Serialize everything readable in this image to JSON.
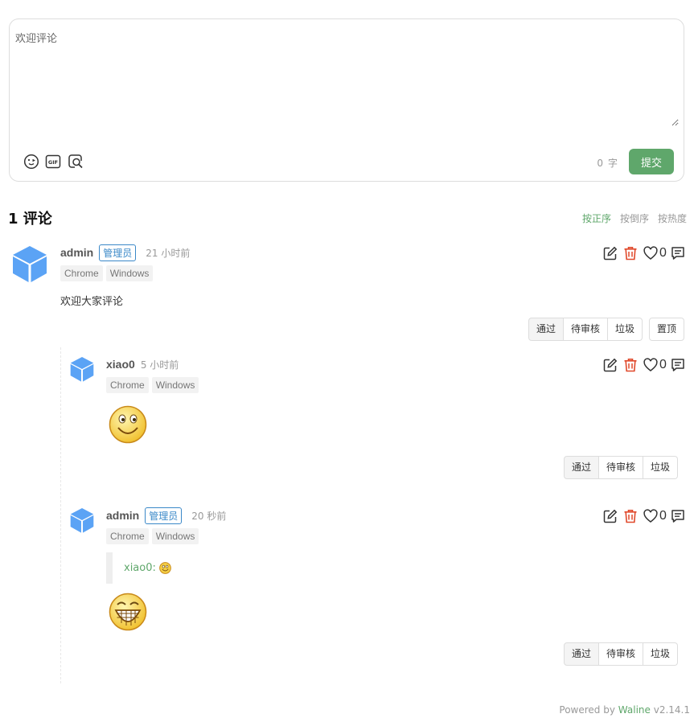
{
  "editor": {
    "placeholder": "欢迎评论",
    "tools": [
      "emoji-icon",
      "gif-icon",
      "search-icon"
    ],
    "count_value": "0",
    "count_unit": "字",
    "submit_label": "提交"
  },
  "comments_header": {
    "count_label": "1 评论",
    "sort": [
      "按正序",
      "按倒序",
      "按热度"
    ],
    "active_sort": "按正序"
  },
  "comments": [
    {
      "nick": "admin",
      "badge": "管理员",
      "time": "21 小时前",
      "browser": "Chrome",
      "os": "Windows",
      "content": "欢迎大家评论",
      "likes": "0",
      "status_buttons": [
        "通过",
        "待审核",
        "垃圾"
      ],
      "sticky_label": "置顶"
    }
  ],
  "replies": [
    {
      "nick": "xiao0",
      "time": "5 小时前",
      "browser": "Chrome",
      "os": "Windows",
      "content_emoji": "smile-emoji",
      "likes": "0",
      "status_buttons": [
        "通过",
        "待审核",
        "垃圾"
      ]
    },
    {
      "nick": "admin",
      "badge": "管理员",
      "time": "20 秒前",
      "browser": "Chrome",
      "os": "Windows",
      "quote_author": "xiao0:",
      "content_emoji": "grin-emoji",
      "likes": "0",
      "status_buttons": [
        "通过",
        "待审核",
        "垃圾"
      ]
    }
  ],
  "footer": {
    "powered_by": "Powered by",
    "brand": "Waline",
    "version": "v2.14.1"
  },
  "colors": {
    "accent": "#5fa76b",
    "admin_badge": "#3a88c8",
    "avatar": "#5ba3f5",
    "delete": "#e0482a"
  }
}
